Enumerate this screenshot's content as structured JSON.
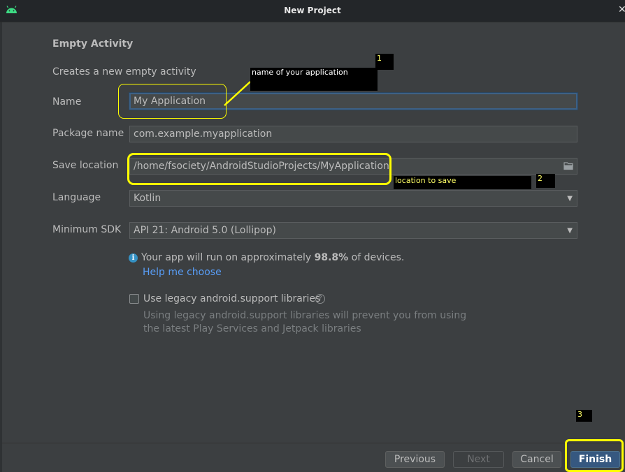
{
  "window": {
    "title": "New Project"
  },
  "form": {
    "heading": "Empty Activity",
    "description": "Creates a new empty activity",
    "name_label": "Name",
    "name_value": "My Application",
    "package_label": "Package name",
    "package_value": "com.example.myapplication",
    "save_label": "Save location",
    "save_value": "/home/fsociety/AndroidStudioProjects/MyApplication",
    "language_label": "Language",
    "language_value": "Kotlin",
    "sdk_label": "Minimum SDK",
    "sdk_value": "API 21: Android 5.0 (Lollipop)"
  },
  "info": {
    "text_before": "Your app will run on approximately ",
    "percent": "98.8%",
    "text_after": " of devices.",
    "help_link": "Help me choose"
  },
  "legacy": {
    "checkbox_label": "Use legacy android.support libraries",
    "checked": false,
    "hint_line1": "Using legacy android.support libraries will prevent you from using",
    "hint_line2": "the latest Play Services and Jetpack libraries"
  },
  "buttons": {
    "previous": "Previous",
    "next": "Next",
    "cancel": "Cancel",
    "finish": "Finish"
  },
  "annotations": {
    "note1_number": "1",
    "note1_text": "name of your application",
    "note2_number": "2",
    "note2_text": "location to save",
    "note3_number": "3"
  },
  "colors": {
    "background": "#3c3f41",
    "field_background": "#45494a",
    "link": "#589df6",
    "primary_button": "#365880",
    "highlight": "#ffff00"
  },
  "icons": {
    "app": "android-icon",
    "folder": "folder-icon",
    "info": "info-icon",
    "help": "question-icon",
    "dropdown": "chevron-down-icon"
  }
}
